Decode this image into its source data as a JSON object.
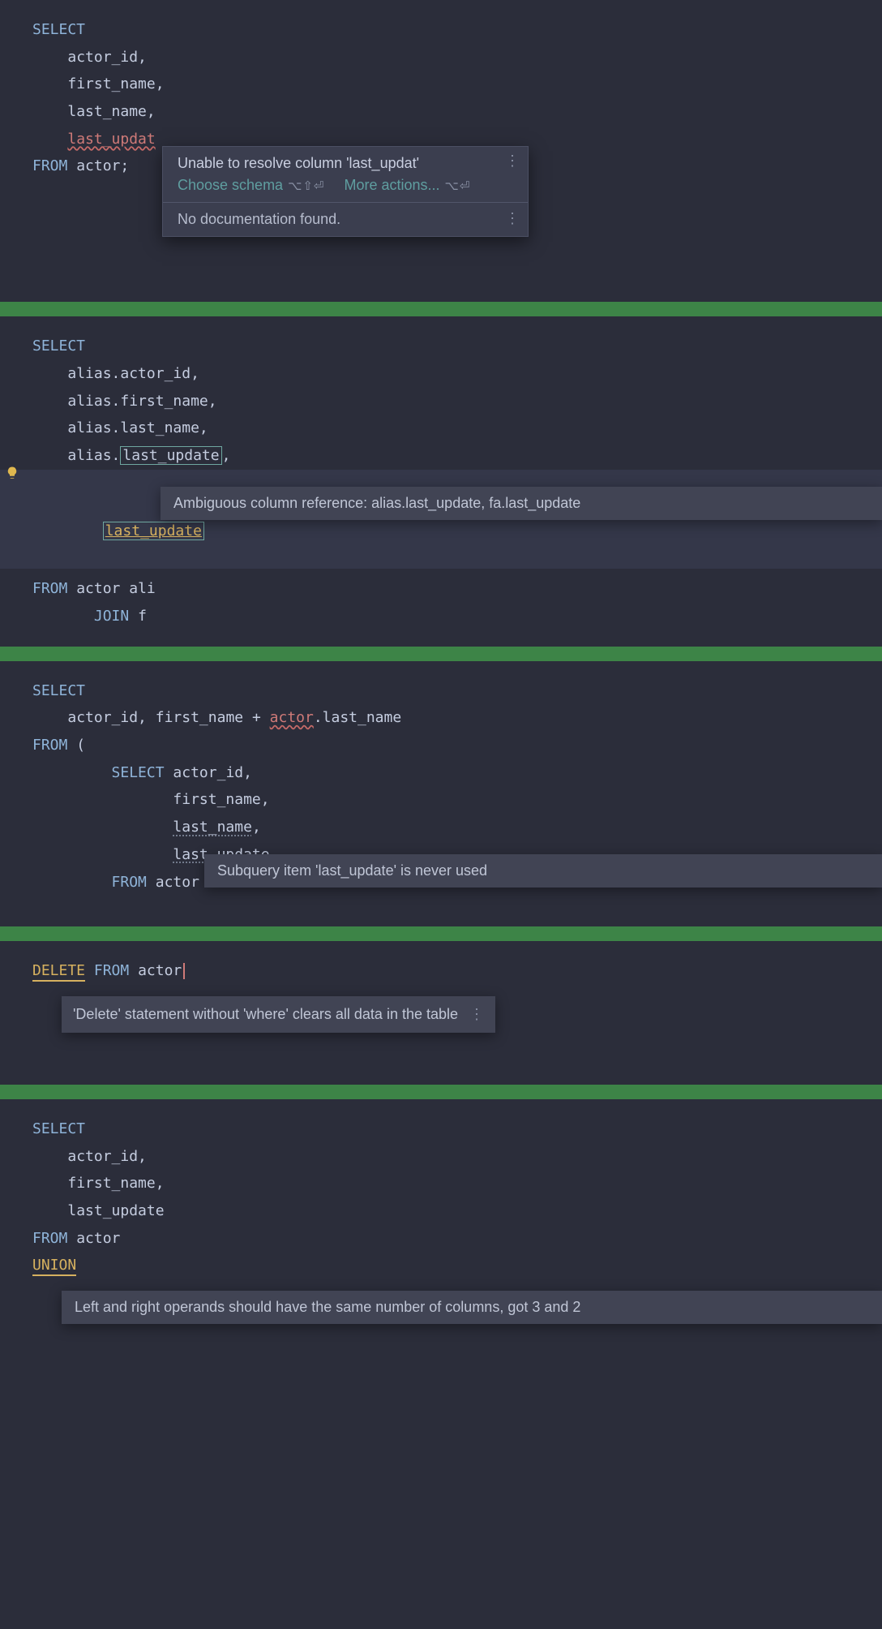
{
  "block1": {
    "kw_select": "SELECT",
    "col1": "actor_id,",
    "col2": "first_name,",
    "col3": "last_name,",
    "col4_err": "last_updat",
    "kw_from": "FROM",
    "table": "actor",
    "semi": ";",
    "tooltip": {
      "title": "Unable to resolve column 'last_updat'",
      "choose": "Choose schema",
      "choose_short": "⌥⇧⏎",
      "more": "More actions...",
      "more_short": "⌥⏎",
      "nodoc": "No documentation found."
    }
  },
  "block2": {
    "kw_select": "SELECT",
    "c1": "alias.actor_id,",
    "c2": "alias.first_name,",
    "c3": "alias.last_name,",
    "c4a": "alias.",
    "c4b": "last_update",
    "c4c": ",",
    "c5": "last_update",
    "kw_from": "FROM",
    "tbl": "actor",
    "alias": "ali",
    "kw_join": "JOIN",
    "j": "f",
    "tooltip_text": "Ambiguous column reference: alias.last_update, fa.last_update"
  },
  "block3": {
    "kw_select": "SELECT",
    "c1": "actor_id,",
    "c2": "first_name",
    "plus": " + ",
    "err": "actor",
    "tail": ".last_name",
    "kw_from": "FROM",
    "paren": "(",
    "inner_select": "SELECT",
    "ic1": "actor_id,",
    "ic2": "first_name,",
    "ic3": "last_name",
    "ic3c": ",",
    "ic4": "last_update",
    "inner_from": "FROM",
    "inner_tbl": "actor",
    "tooltip_text": "Subquery item 'last_update' is never used"
  },
  "block4": {
    "kw_delete": "DELETE",
    "kw_from": "FROM",
    "tbl": "actor",
    "tooltip_text": "'Delete' statement without 'where' clears all data in the table"
  },
  "block5": {
    "kw_select": "SELECT",
    "c1": "actor_id,",
    "c2": "first_name,",
    "c3": "last_update",
    "kw_from": "FROM",
    "tbl": "actor",
    "kw_union": "UNION",
    "tooltip_text": "Left and right operands should have the same number of columns, got 3 and 2"
  }
}
